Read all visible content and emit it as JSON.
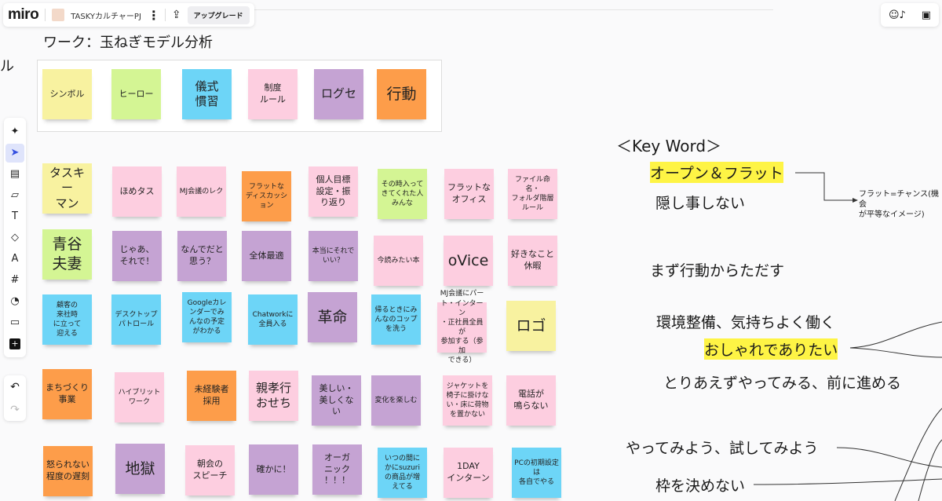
{
  "topbar": {
    "logo": "miro",
    "board_name": "TASKYカルチャーPJ",
    "menu": "⋮",
    "share_icon": "⇪",
    "upgrade": "アップグレード"
  },
  "rightbar": {
    "reactions_icon": "☺♪",
    "presentation_icon": "▣"
  },
  "left_cut_text": "ル",
  "title": "ワーク：玉ねぎモデル分析",
  "toolbar": [
    {
      "name": "ai-sparkle-icon",
      "glyph": "✦"
    },
    {
      "name": "select-cursor-icon",
      "glyph": "➤"
    },
    {
      "name": "templates-icon",
      "glyph": "▤"
    },
    {
      "name": "sticky-note-icon",
      "glyph": "▱"
    },
    {
      "name": "text-icon",
      "glyph": "T"
    },
    {
      "name": "shapes-icon",
      "glyph": "◇"
    },
    {
      "name": "pen-icon",
      "glyph": "A"
    },
    {
      "name": "frame-icon",
      "glyph": "#"
    },
    {
      "name": "palette-icon",
      "glyph": "◔"
    },
    {
      "name": "comment-icon",
      "glyph": "▭"
    },
    {
      "name": "add-more-icon",
      "glyph": "+"
    }
  ],
  "undo": {
    "undo": "↶",
    "redo": "↷"
  },
  "colors": {
    "yellow": "#f8f2a0",
    "green": "#d4f594",
    "blue": "#6dd5f7",
    "pink": "#fdcee0",
    "purple": "#c5a3d3",
    "orange": "#fd9d4a",
    "highlight": "#fef445"
  },
  "legend": [
    {
      "text": "シンボル",
      "color": "yellow"
    },
    {
      "text": "ヒーロー",
      "color": "green"
    },
    {
      "text": "儀式\n慣習",
      "color": "blue"
    },
    {
      "text": "制度\nルール",
      "color": "pink"
    },
    {
      "text": "ログセ",
      "color": "purple"
    },
    {
      "text": "行動",
      "color": "orange"
    }
  ],
  "notes": [
    {
      "text": "タスキー\nマン",
      "color": "yellow"
    },
    {
      "text": "ほめタス",
      "color": "pink"
    },
    {
      "text": "MJ会議のレク",
      "color": "pink"
    },
    {
      "text": "フラットな\nディスカッション",
      "color": "orange"
    },
    {
      "text": "個人目標\n設定・振\nり返り",
      "color": "pink"
    },
    {
      "text": "その時入って\nきてくれた人\nみんな",
      "color": "green"
    },
    {
      "text": "フラットな\nオフィス",
      "color": "pink"
    },
    {
      "text": "ファイル命名・\nフォルダ階層\nルール",
      "color": "pink"
    },
    {
      "text": "青谷\n夫妻",
      "color": "green"
    },
    {
      "text": "じゃあ、\nそれで！",
      "color": "purple"
    },
    {
      "text": "なんでだと\n思う？",
      "color": "purple"
    },
    {
      "text": "全体最適",
      "color": "purple"
    },
    {
      "text": "本当にそれで\nいい？",
      "color": "purple"
    },
    {
      "text": "今読みたい本",
      "color": "pink"
    },
    {
      "text": "oVice",
      "color": "pink"
    },
    {
      "text": "好きなこと\n休暇",
      "color": "pink"
    },
    {
      "text": "顧客の\n来社時\nに立って\n迎える",
      "color": "blue"
    },
    {
      "text": "デスクトップ\nパトロール",
      "color": "blue"
    },
    {
      "text": "Googleカレ\nンダーでみ\nんなの予定\nがわかる",
      "color": "blue"
    },
    {
      "text": "Chatworkに\n全員入る",
      "color": "blue"
    },
    {
      "text": "革命",
      "color": "purple"
    },
    {
      "text": "帰るときにみ\nんなのコップ\nを洗う",
      "color": "blue"
    },
    {
      "text": "MJ会議にパー\nト・インターン\n・正社員全員が\n参加する（参加\nできる）",
      "color": "pink"
    },
    {
      "text": "ロゴ",
      "color": "yellow"
    },
    {
      "text": "まちづくり\n事業",
      "color": "orange"
    },
    {
      "text": "ハイブリット\nワーク",
      "color": "pink"
    },
    {
      "text": "未経験者\n採用",
      "color": "orange"
    },
    {
      "text": "親孝行\nおせち",
      "color": "pink"
    },
    {
      "text": "美しい・\n美しくな\nい",
      "color": "purple"
    },
    {
      "text": "変化を楽しむ",
      "color": "purple"
    },
    {
      "text": "ジャケットを\n椅子に掛けな\nい・床に荷物\nを置かない",
      "color": "pink"
    },
    {
      "text": "電話が\n鳴らない",
      "color": "pink"
    },
    {
      "text": "怒られない\n程度の遅刻",
      "color": "orange"
    },
    {
      "text": "地獄",
      "color": "purple"
    },
    {
      "text": "朝会の\nスピーチ",
      "color": "pink"
    },
    {
      "text": "確かに！",
      "color": "purple"
    },
    {
      "text": "オーガ\nニック\n！！！",
      "color": "purple"
    },
    {
      "text": "いつの間に\nかにsuzuri\nの商品が増\nえてる",
      "color": "blue"
    },
    {
      "text": "1DAY\nインターン",
      "color": "pink"
    },
    {
      "text": "PCの初期設定は\n各自でやる",
      "color": "blue"
    }
  ],
  "keywords": {
    "heading": "＜Key Word＞",
    "items": [
      "オープン＆フラット",
      "隠し事しない",
      "まず行動からただす",
      "環境整備、気持ちよく働く",
      "おしゃれでありたい",
      "とりあえずやってみる、前に進める",
      "やってみよう、試してみよう",
      "枠を決めない"
    ],
    "annotation": "フラット=チャンス(機会\nが平等なイメージ)"
  }
}
